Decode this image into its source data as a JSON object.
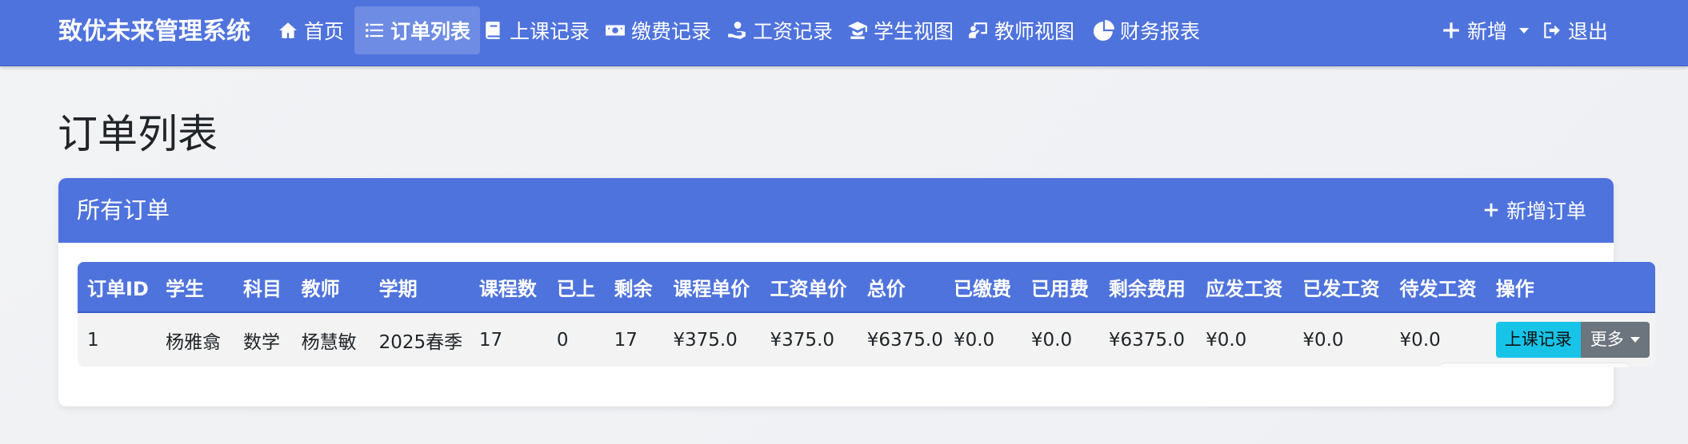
{
  "app": {
    "brand": "致优未来管理系统"
  },
  "nav": {
    "items": [
      {
        "label": "首页",
        "icon": "home-icon"
      },
      {
        "label": "订单列表",
        "icon": "list-icon",
        "active": true
      },
      {
        "label": "上课记录",
        "icon": "book-icon"
      },
      {
        "label": "缴费记录",
        "icon": "money-icon"
      },
      {
        "label": "工资记录",
        "icon": "hand-coin-icon"
      },
      {
        "label": "学生视图",
        "icon": "student-icon"
      },
      {
        "label": "教师视图",
        "icon": "teacher-icon"
      },
      {
        "label": "财务报表",
        "icon": "pie-chart-icon"
      }
    ],
    "add": "新增",
    "logout": "退出"
  },
  "page": {
    "title": "订单列表"
  },
  "card": {
    "title": "所有订单",
    "new_order": "新增订单"
  },
  "table": {
    "headers": [
      "订单ID",
      "学生",
      "科目",
      "教师",
      "学期",
      "课程数",
      "已上",
      "剩余",
      "课程单价",
      "工资单价",
      "总价",
      "已缴费",
      "已用费",
      "剩余费用",
      "应发工资",
      "已发工资",
      "待发工资",
      "操作"
    ],
    "rows": [
      [
        "1",
        "杨雅翕",
        "数学",
        "杨慧敏",
        "2025春季",
        "17",
        "0",
        "17",
        "¥375.0",
        "¥375.0",
        "¥6375.0",
        "¥0.0",
        "¥0.0",
        "¥6375.0",
        "¥0.0",
        "¥0.0",
        "¥0.0"
      ]
    ],
    "actions": {
      "records": "上课记录",
      "more": "更多"
    }
  },
  "colors": {
    "primary": "#4f73dd",
    "info": "#17c4e8",
    "secondary": "#6c757d"
  }
}
